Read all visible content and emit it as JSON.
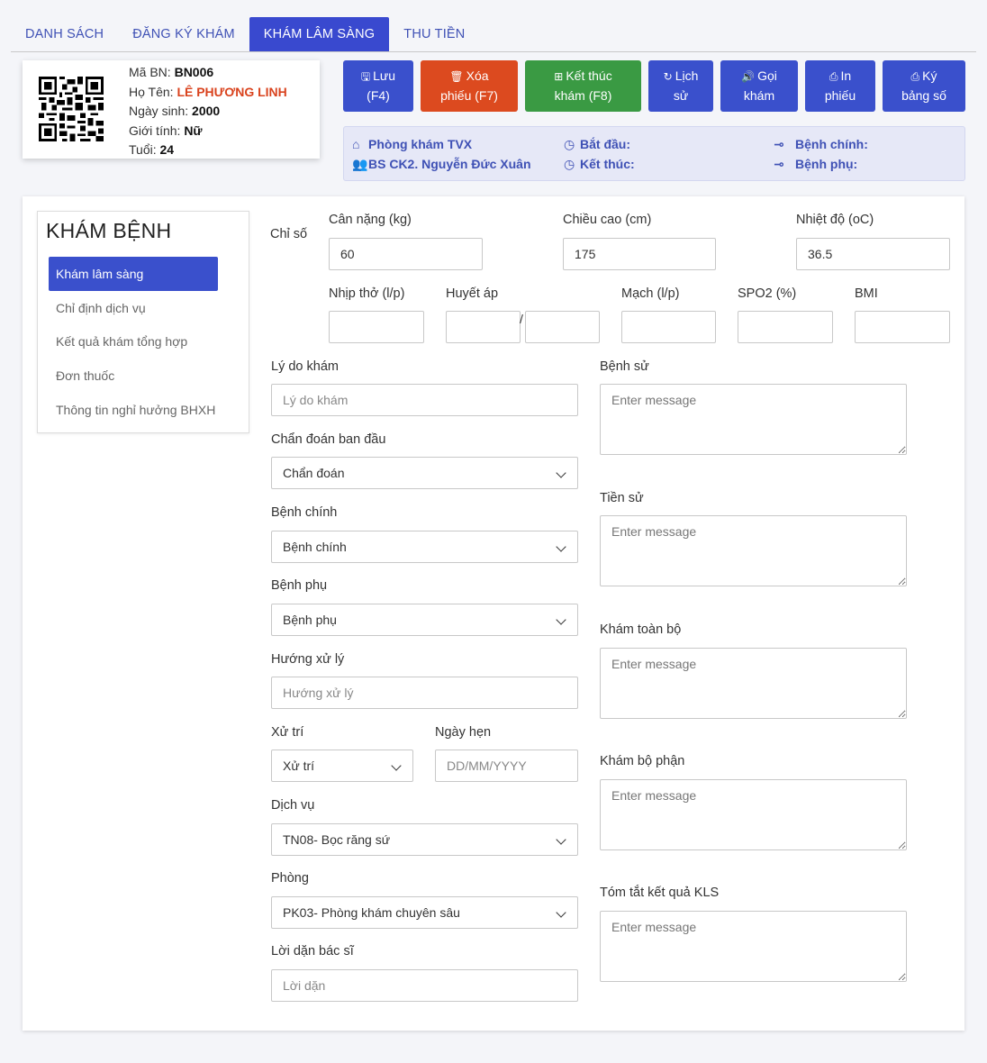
{
  "tabs": [
    "DANH SÁCH",
    "ĐĂNG KÝ KHÁM",
    "KHÁM LÂM SÀNG",
    "THU TIỀN"
  ],
  "patient": {
    "code_label": "Mã BN: ",
    "code": "BN006",
    "name_label": "Họ Tên: ",
    "name": "LÊ PHƯƠNG LINH",
    "dob_label": "Ngày sinh: ",
    "dob": "2000",
    "gender_label": "Giới tính: ",
    "gender": "Nữ",
    "age_label": "Tuổi: ",
    "age": "24"
  },
  "toolbar": {
    "save": [
      "Lưu",
      "(F4)"
    ],
    "delete": [
      "Xóa",
      "phiếu (F7)"
    ],
    "finish": [
      "Kết thúc",
      "khám (F8)"
    ],
    "history": [
      "Lịch",
      "sử"
    ],
    "call": [
      "Gọi",
      "khám"
    ],
    "print": [
      "In",
      "phiếu"
    ],
    "sign": [
      "Ký",
      "bảng số"
    ]
  },
  "info": {
    "clinic": "Phòng khám TVX",
    "doctor": "BS CK2. Nguyễn Đức Xuân",
    "start": "Bắt đầu:",
    "end": "Kết thúc:",
    "main_disease": "Bệnh chính:",
    "sub_disease": "Bệnh phụ:"
  },
  "side": {
    "title": "KHÁM BỆNH",
    "items": [
      "Khám lâm sàng",
      "Chỉ định dịch vụ",
      "Kết quả khám tổng hợp",
      "Đơn thuốc",
      "Thông tin nghỉ hưởng BHXH"
    ]
  },
  "vitals": {
    "section_label": "Chỉ số",
    "weight_label": "Cân nặng (kg)",
    "weight": "60",
    "height_label": "Chiều cao (cm)",
    "height": "175",
    "temp_label": "Nhiệt độ (oC)",
    "temp": "36.5",
    "resp_label": "Nhịp thở (l/p)",
    "bp_label": "Huyết áp",
    "bp_sep": "/",
    "pulse_label": "Mạch (l/p)",
    "spo2_label": "SPO2 (%)",
    "bmi_label": "BMI"
  },
  "form": {
    "reason_label": "Lý do khám",
    "reason_ph": "Lý do khám",
    "initial_dx_label": "Chẩn đoán ban đầu",
    "initial_dx": "Chẩn đoán",
    "main_label": "Bệnh chính",
    "main": "Bệnh chính",
    "sub_label": "Bệnh phụ",
    "sub": "Bệnh phụ",
    "direction_label": "Hướng xử lý",
    "direction_ph": "Hướng xử lý",
    "handle_label": "Xử trí",
    "handle": "Xử trí",
    "appt_label": "Ngày hẹn",
    "appt_ph": "DD/MM/YYYY",
    "service_label": "Dịch vụ",
    "service": "TN08- Bọc răng sứ",
    "room_label": "Phòng",
    "room": "PK03- Phòng khám chuyên sâu",
    "advice_label": "Lời dặn bác sĩ",
    "advice_ph": "Lời dặn",
    "history_label": "Bệnh sử",
    "past_label": "Tiền sử",
    "full_exam_label": "Khám toàn bộ",
    "part_exam_label": "Khám bộ phận",
    "summary_label": "Tóm tắt kết quả KLS",
    "textarea_ph": "Enter message"
  },
  "colors": {
    "primary": "#3a50cc",
    "danger": "#dc4a1f",
    "success": "#3a9a43",
    "patient_name": "#d9431e"
  }
}
